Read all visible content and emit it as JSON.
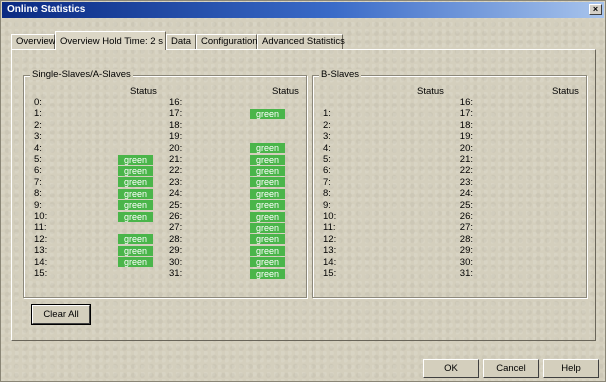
{
  "window": {
    "title": "Online Statistics",
    "close_icon": "×"
  },
  "tabs": [
    {
      "label": "Overview"
    },
    {
      "label": "Overview  Hold Time: 2 s"
    },
    {
      "label": "Data"
    },
    {
      "label": "Configuration"
    },
    {
      "label": "Advanced Statistics"
    }
  ],
  "groups": {
    "a": {
      "title": "Single-Slaves/A-Slaves",
      "status_head": "Status",
      "left": [
        {
          "num": "0:",
          "status": ""
        },
        {
          "num": "1:",
          "status": ""
        },
        {
          "num": "2:",
          "status": ""
        },
        {
          "num": "3:",
          "status": ""
        },
        {
          "num": "4:",
          "status": ""
        },
        {
          "num": "5:",
          "status": "green"
        },
        {
          "num": "6:",
          "status": "green"
        },
        {
          "num": "7:",
          "status": "green"
        },
        {
          "num": "8:",
          "status": "green"
        },
        {
          "num": "9:",
          "status": "green"
        },
        {
          "num": "10:",
          "status": "green"
        },
        {
          "num": "11:",
          "status": ""
        },
        {
          "num": "12:",
          "status": "green"
        },
        {
          "num": "13:",
          "status": "green"
        },
        {
          "num": "14:",
          "status": "green"
        },
        {
          "num": "15:",
          "status": ""
        }
      ],
      "right": [
        {
          "num": "16:",
          "status": ""
        },
        {
          "num": "17:",
          "status": "green"
        },
        {
          "num": "18:",
          "status": ""
        },
        {
          "num": "19:",
          "status": ""
        },
        {
          "num": "20:",
          "status": "green"
        },
        {
          "num": "21:",
          "status": "green"
        },
        {
          "num": "22:",
          "status": "green"
        },
        {
          "num": "23:",
          "status": "green"
        },
        {
          "num": "24:",
          "status": "green"
        },
        {
          "num": "25:",
          "status": "green"
        },
        {
          "num": "26:",
          "status": "green"
        },
        {
          "num": "27:",
          "status": "green"
        },
        {
          "num": "28:",
          "status": "green"
        },
        {
          "num": "29:",
          "status": "green"
        },
        {
          "num": "30:",
          "status": "green"
        },
        {
          "num": "31:",
          "status": "green"
        }
      ]
    },
    "b": {
      "title": "B-Slaves",
      "status_head": "Status",
      "left": [
        {
          "num": "",
          "status": ""
        },
        {
          "num": "1:",
          "status": ""
        },
        {
          "num": "2:",
          "status": ""
        },
        {
          "num": "3:",
          "status": ""
        },
        {
          "num": "4:",
          "status": ""
        },
        {
          "num": "5:",
          "status": ""
        },
        {
          "num": "6:",
          "status": ""
        },
        {
          "num": "7:",
          "status": ""
        },
        {
          "num": "8:",
          "status": ""
        },
        {
          "num": "9:",
          "status": ""
        },
        {
          "num": "10:",
          "status": ""
        },
        {
          "num": "11:",
          "status": ""
        },
        {
          "num": "12:",
          "status": ""
        },
        {
          "num": "13:",
          "status": ""
        },
        {
          "num": "14:",
          "status": ""
        },
        {
          "num": "15:",
          "status": ""
        }
      ],
      "right": [
        {
          "num": "16:",
          "status": ""
        },
        {
          "num": "17:",
          "status": ""
        },
        {
          "num": "18:",
          "status": ""
        },
        {
          "num": "19:",
          "status": ""
        },
        {
          "num": "20:",
          "status": ""
        },
        {
          "num": "21:",
          "status": ""
        },
        {
          "num": "22:",
          "status": ""
        },
        {
          "num": "23:",
          "status": ""
        },
        {
          "num": "24:",
          "status": ""
        },
        {
          "num": "25:",
          "status": ""
        },
        {
          "num": "26:",
          "status": ""
        },
        {
          "num": "27:",
          "status": ""
        },
        {
          "num": "28:",
          "status": ""
        },
        {
          "num": "29:",
          "status": ""
        },
        {
          "num": "30:",
          "status": ""
        },
        {
          "num": "31:",
          "status": ""
        }
      ]
    }
  },
  "buttons": {
    "clear_all": "Clear All",
    "ok": "OK",
    "cancel": "Cancel",
    "help": "Help"
  },
  "colors": {
    "status_green": "#4ab54a"
  }
}
